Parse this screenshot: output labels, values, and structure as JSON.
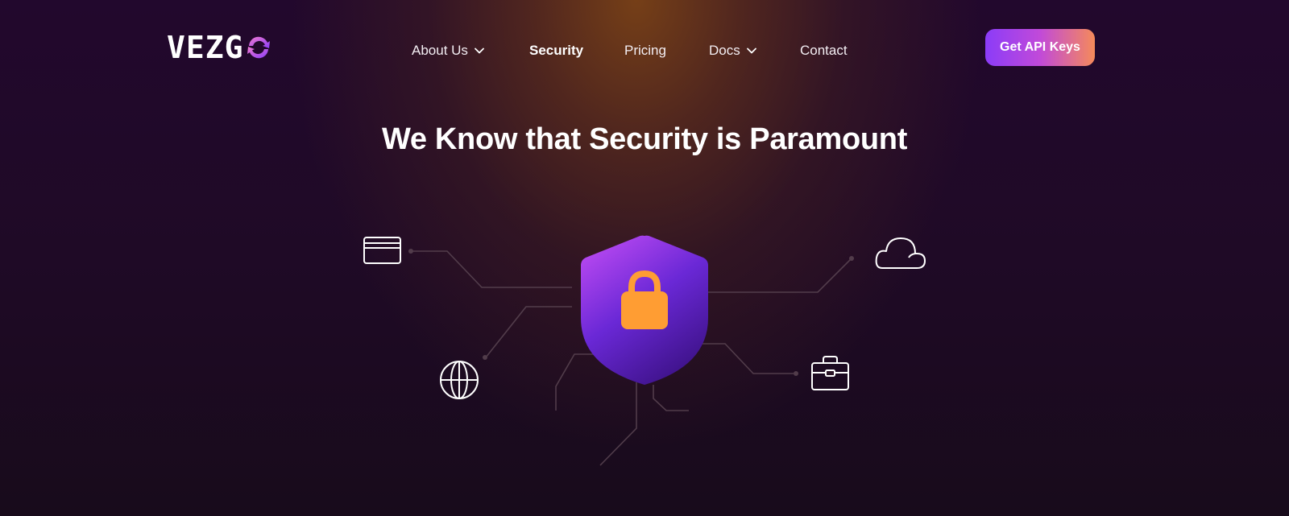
{
  "brand": {
    "name": "VEZGO",
    "text": "VEZG",
    "mark_icon": "refresh-o-icon"
  },
  "nav": {
    "items": [
      {
        "label": "About Us",
        "has_dropdown": true,
        "active": false
      },
      {
        "label": "Security",
        "has_dropdown": false,
        "active": true
      },
      {
        "label": "Pricing",
        "has_dropdown": false,
        "active": false
      },
      {
        "label": "Docs",
        "has_dropdown": true,
        "active": false
      },
      {
        "label": "Contact",
        "has_dropdown": false,
        "active": false
      }
    ]
  },
  "cta": {
    "label": "Get API Keys"
  },
  "hero": {
    "title": "We Know that Security is Paramount"
  },
  "illustration": {
    "center_icon": "shield-lock-icon",
    "satellite_icons": [
      "credit-card-icon",
      "cloud-icon",
      "globe-icon",
      "briefcase-icon"
    ]
  },
  "colors": {
    "accent_purple": "#8b3cf8",
    "accent_orange": "#f58a5a",
    "lock_orange": "#ff9d33",
    "shield_top": "#b347f0",
    "shield_bottom": "#3e1590",
    "background": "#1c0a22"
  }
}
